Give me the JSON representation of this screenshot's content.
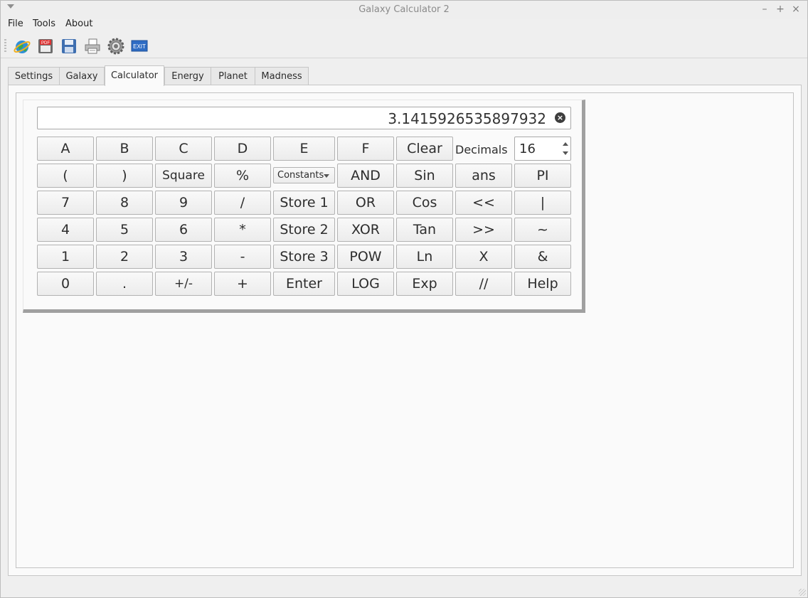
{
  "window": {
    "title": "Galaxy Calculator 2",
    "minimize": "–",
    "maximize": "+",
    "close": "×"
  },
  "menu": {
    "file": "File",
    "tools": "Tools",
    "about": "About"
  },
  "toolbar": {
    "icons": [
      "globe-icon",
      "pdf-icon",
      "save-icon",
      "printer-icon",
      "settings-icon",
      "exit-icon"
    ],
    "exit_label": "EXIT",
    "pdf_label": "PDF"
  },
  "tabs": [
    "Settings",
    "Galaxy",
    "Calculator",
    "Energy",
    "Planet",
    "Madness"
  ],
  "active_tab": "Calculator",
  "calculator": {
    "display": "3.1415926535897932",
    "decimals_label": "Decimals",
    "decimals_value": "16",
    "constants_label": "Constants",
    "keys": {
      "row1": [
        "A",
        "B",
        "C",
        "D",
        "E",
        "F",
        "Clear"
      ],
      "row2": [
        "(",
        ")",
        "Square",
        "%",
        "AND",
        "Sin",
        "ans",
        "PI"
      ],
      "row3": [
        "7",
        "8",
        "9",
        "/",
        "Store 1",
        "OR",
        "Cos",
        "<<",
        "|"
      ],
      "row4": [
        "4",
        "5",
        "6",
        "*",
        "Store 2",
        "XOR",
        "Tan",
        ">>",
        "~"
      ],
      "row5": [
        "1",
        "2",
        "3",
        "-",
        "Store 3",
        "POW",
        "Ln",
        "X",
        "&"
      ],
      "row6": [
        "0",
        ".",
        "+/-",
        "+",
        "Enter",
        "LOG",
        "Exp",
        "//",
        "Help"
      ]
    }
  }
}
